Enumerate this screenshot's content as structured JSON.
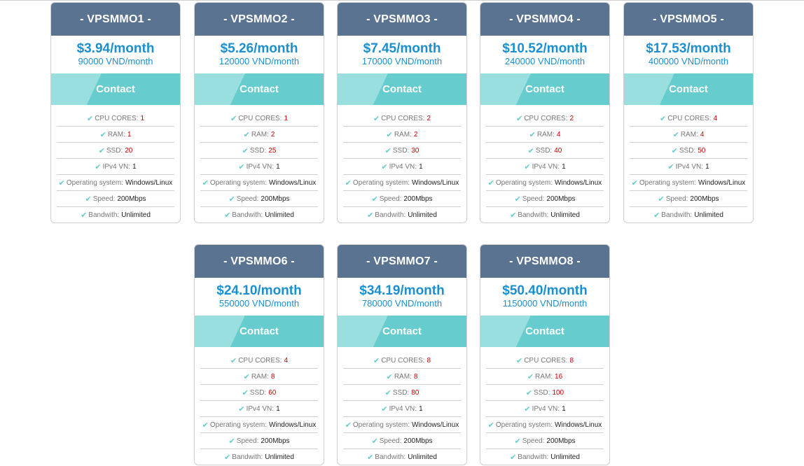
{
  "plans": [
    {
      "name": "- VPSMMO1 -",
      "usd": "$3.94/month",
      "vnd": "90000 VND/month",
      "contact": "Contact",
      "features": [
        {
          "label": "CPU CORES:",
          "value": "1",
          "highlight": true
        },
        {
          "label": "RAM:",
          "value": "1",
          "highlight": true
        },
        {
          "label": "SSD:",
          "value": "20",
          "highlight": true
        },
        {
          "label": "IPv4 VN:",
          "value": "1",
          "highlight": false
        },
        {
          "label": "Operating system:",
          "value": "Windows/Linux",
          "highlight": false
        },
        {
          "label": "Speed:",
          "value": "200Mbps",
          "highlight": false
        },
        {
          "label": "Bandwith:",
          "value": "Unlimited",
          "highlight": false
        }
      ]
    },
    {
      "name": "- VPSMMO2 -",
      "usd": "$5.26/month",
      "vnd": "120000 VND/month",
      "contact": "Contact",
      "features": [
        {
          "label": "CPU CORES:",
          "value": "1",
          "highlight": true
        },
        {
          "label": "RAM:",
          "value": "2",
          "highlight": true
        },
        {
          "label": "SSD:",
          "value": "25",
          "highlight": true
        },
        {
          "label": "IPv4 VN:",
          "value": "1",
          "highlight": false
        },
        {
          "label": "Operating system:",
          "value": "Windows/Linux",
          "highlight": false
        },
        {
          "label": "Speed:",
          "value": "200Mbps",
          "highlight": false
        },
        {
          "label": "Bandwith:",
          "value": "Unlimited",
          "highlight": false
        }
      ]
    },
    {
      "name": "- VPSMMO3 -",
      "usd": "$7.45/month",
      "vnd": "170000 VND/month",
      "contact": "Contact",
      "features": [
        {
          "label": "CPU CORES:",
          "value": "2",
          "highlight": true
        },
        {
          "label": "RAM:",
          "value": "2",
          "highlight": true
        },
        {
          "label": "SSD:",
          "value": "30",
          "highlight": true
        },
        {
          "label": "IPv4 VN:",
          "value": "1",
          "highlight": false
        },
        {
          "label": "Operating system:",
          "value": "Windows/Linux",
          "highlight": false
        },
        {
          "label": "Speed:",
          "value": "200Mbps",
          "highlight": false
        },
        {
          "label": "Bandwith:",
          "value": "Unlimited",
          "highlight": false
        }
      ]
    },
    {
      "name": "- VPSMMO4 -",
      "usd": "$10.52/month",
      "vnd": "240000 VND/month",
      "contact": "Contact",
      "features": [
        {
          "label": "CPU CORES:",
          "value": "2",
          "highlight": true
        },
        {
          "label": "RAM:",
          "value": "4",
          "highlight": true
        },
        {
          "label": "SSD:",
          "value": "40",
          "highlight": true
        },
        {
          "label": "IPv4 VN:",
          "value": "1",
          "highlight": false
        },
        {
          "label": "Operating system:",
          "value": "Windows/Linux",
          "highlight": false
        },
        {
          "label": "Speed:",
          "value": "200Mbps",
          "highlight": false
        },
        {
          "label": "Bandwith:",
          "value": "Unlimited",
          "highlight": false
        }
      ]
    },
    {
      "name": "- VPSMMO5 -",
      "usd": "$17.53/month",
      "vnd": "400000 VND/month",
      "contact": "Contact",
      "features": [
        {
          "label": "CPU CORES:",
          "value": "4",
          "highlight": true
        },
        {
          "label": "RAM:",
          "value": "4",
          "highlight": true
        },
        {
          "label": "SSD:",
          "value": "50",
          "highlight": true
        },
        {
          "label": "IPv4 VN:",
          "value": "1",
          "highlight": false
        },
        {
          "label": "Operating system:",
          "value": "Windows/Linux",
          "highlight": false
        },
        {
          "label": "Speed:",
          "value": "200Mbps",
          "highlight": false
        },
        {
          "label": "Bandwith:",
          "value": "Unlimited",
          "highlight": false
        }
      ]
    },
    {
      "name": "- VPSMMO6 -",
      "usd": "$24.10/month",
      "vnd": "550000 VND/month",
      "contact": "Contact",
      "features": [
        {
          "label": "CPU CORES:",
          "value": "4",
          "highlight": true
        },
        {
          "label": "RAM:",
          "value": "8",
          "highlight": true
        },
        {
          "label": "SSD:",
          "value": "60",
          "highlight": true
        },
        {
          "label": "IPv4 VN:",
          "value": "1",
          "highlight": false
        },
        {
          "label": "Operating system:",
          "value": "Windows/Linux",
          "highlight": false
        },
        {
          "label": "Speed:",
          "value": "200Mbps",
          "highlight": false
        },
        {
          "label": "Bandwith:",
          "value": "Unlimited",
          "highlight": false
        }
      ]
    },
    {
      "name": "- VPSMMO7 -",
      "usd": "$34.19/month",
      "vnd": "780000 VND/month",
      "contact": "Contact",
      "features": [
        {
          "label": "CPU CORES:",
          "value": "8",
          "highlight": true
        },
        {
          "label": "RAM:",
          "value": "8",
          "highlight": true
        },
        {
          "label": "SSD:",
          "value": "80",
          "highlight": true
        },
        {
          "label": "IPv4 VN:",
          "value": "1",
          "highlight": false
        },
        {
          "label": "Operating system:",
          "value": "Windows/Linux",
          "highlight": false
        },
        {
          "label": "Speed:",
          "value": "200Mbps",
          "highlight": false
        },
        {
          "label": "Bandwith:",
          "value": "Unlimited",
          "highlight": false
        }
      ]
    },
    {
      "name": "- VPSMMO8 -",
      "usd": "$50.40/month",
      "vnd": "1150000 VND/month",
      "contact": "Contact",
      "features": [
        {
          "label": "CPU CORES:",
          "value": "8",
          "highlight": true
        },
        {
          "label": "RAM:",
          "value": "16",
          "highlight": true
        },
        {
          "label": "SSD:",
          "value": "100",
          "highlight": true
        },
        {
          "label": "IPv4 VN:",
          "value": "1",
          "highlight": false
        },
        {
          "label": "Operating system:",
          "value": "Windows/Linux",
          "highlight": false
        },
        {
          "label": "Speed:",
          "value": "200Mbps",
          "highlight": false
        },
        {
          "label": "Bandwith:",
          "value": "Unlimited",
          "highlight": false
        }
      ]
    }
  ],
  "icons": {
    "feature_check": "check-icon"
  },
  "colors": {
    "header": "#5a7390",
    "price": "#1b8fd0",
    "button_light": "#9adfdf",
    "button_dark": "#66cccd",
    "value_red": "#cc0000"
  }
}
